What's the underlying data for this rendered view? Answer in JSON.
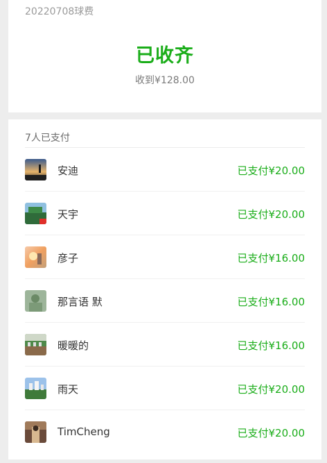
{
  "top": {
    "note": "20220708球费",
    "status": "已收齐",
    "received": "收到¥128.00"
  },
  "list": {
    "header": "7人已支付",
    "items": [
      {
        "name": "安迪",
        "amount": "已支付¥20.00",
        "avatar": "avatar-1"
      },
      {
        "name": "天宇",
        "amount": "已支付¥20.00",
        "avatar": "avatar-2"
      },
      {
        "name": "彦子",
        "amount": "已支付¥16.00",
        "avatar": "avatar-3"
      },
      {
        "name": "那言语 默",
        "amount": "已支付¥16.00",
        "avatar": "avatar-4"
      },
      {
        "name": "暖暖的",
        "amount": "已支付¥16.00",
        "avatar": "avatar-5"
      },
      {
        "name": "雨天",
        "amount": "已支付¥20.00",
        "avatar": "avatar-6"
      },
      {
        "name": "TimCheng",
        "amount": "已支付¥20.00",
        "avatar": "avatar-7"
      }
    ]
  },
  "colors": {
    "accent": "#1aad19",
    "background": "#ededed",
    "card": "#ffffff"
  }
}
